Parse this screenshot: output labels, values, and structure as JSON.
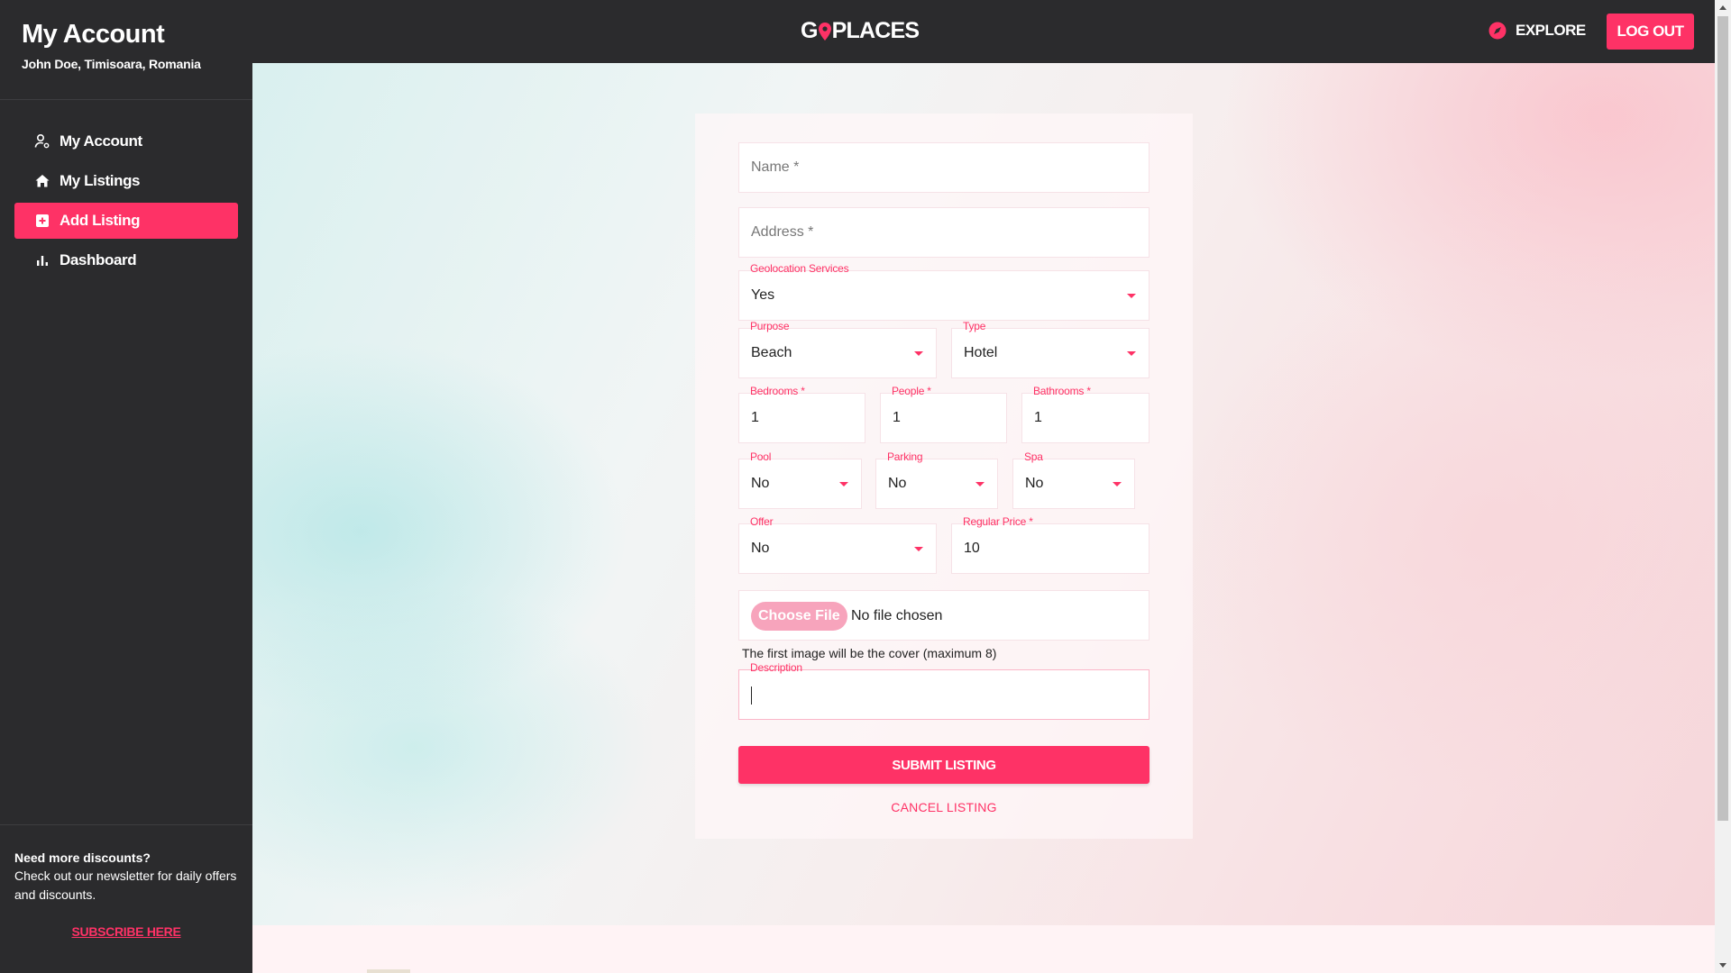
{
  "colors": {
    "accent": "#fe3266",
    "dark": "#2b2b2d"
  },
  "sidebar": {
    "title": "My Account",
    "subtitle": "John Doe, Timisoara, Romania",
    "items": [
      {
        "label": "My Account",
        "icon": "user-settings-icon"
      },
      {
        "label": "My Listings",
        "icon": "home-icon"
      },
      {
        "label": "Add Listing",
        "icon": "add-box-icon",
        "active": true
      },
      {
        "label": "Dashboard",
        "icon": "bar-chart-icon"
      }
    ],
    "footer": {
      "heading": "Need more discounts?",
      "text": "Check out our newsletter for daily offers and discounts.",
      "link": "SUBSCRIBE HERE"
    }
  },
  "topbar": {
    "logo_left": "G",
    "logo_right": "PLACES",
    "explore": "EXPLORE",
    "logout": "LOG OUT"
  },
  "form": {
    "name": {
      "placeholder": "Name *"
    },
    "address": {
      "placeholder": "Address *"
    },
    "geolocation": {
      "label": "Geolocation Services",
      "value": "Yes"
    },
    "purpose": {
      "label": "Purpose",
      "value": "Beach"
    },
    "type": {
      "label": "Type",
      "value": "Hotel"
    },
    "bedrooms": {
      "label": "Bedrooms *",
      "value": "1"
    },
    "people": {
      "label": "People *",
      "value": "1"
    },
    "bathrooms": {
      "label": "Bathrooms *",
      "value": "1"
    },
    "pool": {
      "label": "Pool",
      "value": "No"
    },
    "parking": {
      "label": "Parking",
      "value": "No"
    },
    "spa": {
      "label": "Spa",
      "value": "No"
    },
    "offer": {
      "label": "Offer",
      "value": "No"
    },
    "regular_price": {
      "label": "Regular Price *",
      "value": "10"
    },
    "file": {
      "button": "Choose File",
      "status": "No file chosen"
    },
    "file_hint": "The first image will be the cover (maximum 8)",
    "description": {
      "label": "Description",
      "value": ""
    },
    "submit": "SUBMIT LISTING",
    "cancel": "CANCEL LISTING"
  }
}
